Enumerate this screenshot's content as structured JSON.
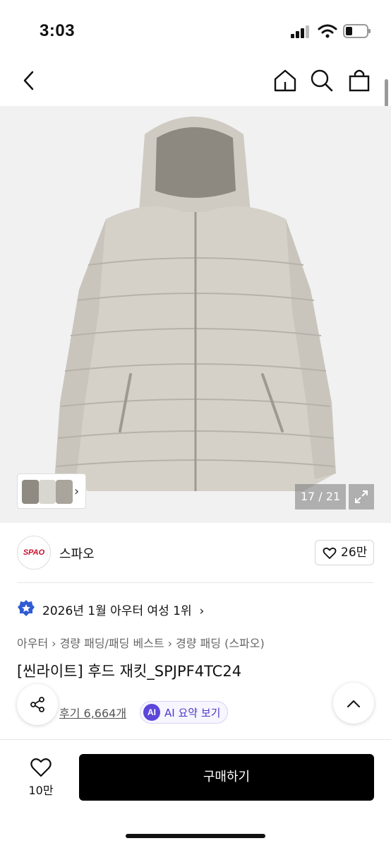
{
  "status_bar": {
    "time": "3:03"
  },
  "gallery": {
    "counter": "17 / 21"
  },
  "brand": {
    "logo_text": "SPAO",
    "name": "스파오",
    "likes": "26만"
  },
  "ranking": {
    "text": "2026년 1월 아우터 여성 1위"
  },
  "breadcrumb": [
    "아우터",
    "경량 패딩/패딩 베스트",
    "경량 패딩 (스파오)"
  ],
  "product": {
    "title": "[씬라이트] 후드 재킷_SPJPF4TC24",
    "reviews": "후기 6,664개",
    "ai_badge": "AI",
    "ai_label": "AI 요약 보기"
  },
  "bottom_bar": {
    "favorites": "10만",
    "buy_label": "구매하기"
  },
  "colors": {
    "accent_ai": "#5b46d9",
    "brand_red": "#c8102e",
    "jacket": "#cfcbc2"
  }
}
